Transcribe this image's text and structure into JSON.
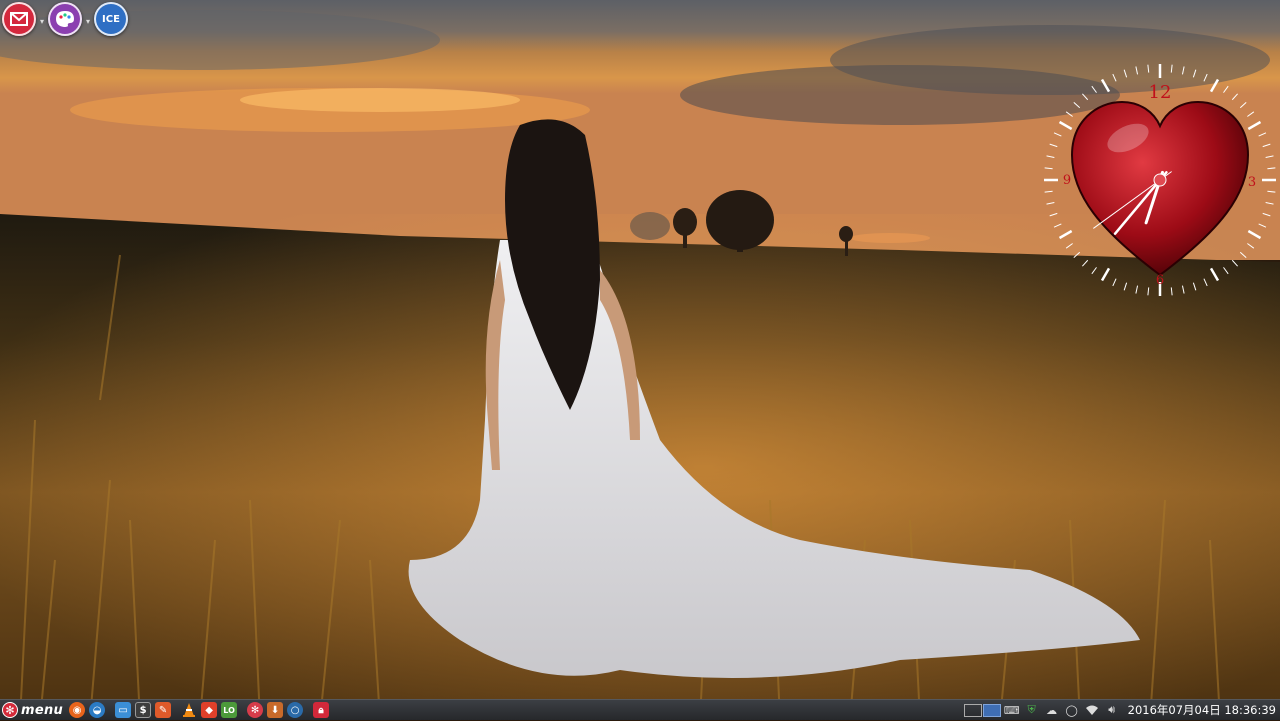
{
  "desktop": {
    "top_launchers": [
      {
        "name": "mail-launcher",
        "icon": "envelope-icon",
        "color": "#d4283d",
        "has_arrow": true
      },
      {
        "name": "paint-launcher",
        "icon": "palette-icon",
        "color": "#8b3fb0",
        "has_arrow": true
      },
      {
        "name": "ice-launcher",
        "icon": "ice-ssb-icon",
        "label": "ICE",
        "color": "#2f6fc4",
        "has_arrow": false
      }
    ],
    "clock_widget": {
      "numerals": [
        "12",
        "3",
        "6",
        "9"
      ],
      "time_shown": "18:36:39",
      "colors": {
        "heart": "#b0101c",
        "hands": "#ffffff",
        "numerals": "#c0101a"
      }
    }
  },
  "panel": {
    "menu_label": "menu",
    "launchers": [
      {
        "name": "firefox-launcher",
        "icon": "firefox-icon",
        "color": "#e8641b"
      },
      {
        "name": "thunderbird-launcher",
        "icon": "thunderbird-icon",
        "color": "#2b7bc4"
      },
      {
        "name": "file-manager-launcher",
        "icon": "folder-window-icon",
        "color": "#3b8fd6"
      },
      {
        "name": "terminal-launcher",
        "icon": "dollar-terminal-icon",
        "label": "$",
        "color": "#3d3d3d"
      },
      {
        "name": "text-editor-launcher",
        "icon": "pencil-icon",
        "color": "#e05a2a"
      },
      {
        "name": "vlc-launcher",
        "icon": "traffic-cone-icon",
        "color": "#f08a12"
      },
      {
        "name": "software-center-launcher",
        "icon": "shopping-bag-icon",
        "color": "#e0402a"
      },
      {
        "name": "libreoffice-launcher",
        "icon": "libreoffice-icon",
        "label": "LO",
        "color": "#4c9a3a"
      },
      {
        "name": "help-launcher",
        "icon": "lifebuoy-icon",
        "color": "#d63c4a"
      },
      {
        "name": "download-launcher",
        "icon": "download-icon",
        "color": "#c86a2a"
      },
      {
        "name": "browser-launcher",
        "icon": "circle-browser-icon",
        "color": "#2a6aa8"
      },
      {
        "name": "lock-screen-launcher",
        "icon": "padlock-icon",
        "color": "#d2283a"
      }
    ],
    "workspaces": [
      {
        "active": false
      },
      {
        "active": true
      }
    ],
    "tray_icons": [
      "keyboard-icon",
      "shield-icon",
      "cloud-weather-icon",
      "power-icon",
      "wifi-icon",
      "volume-icon"
    ],
    "datetime": "2016年07月04日 18:36:39"
  }
}
